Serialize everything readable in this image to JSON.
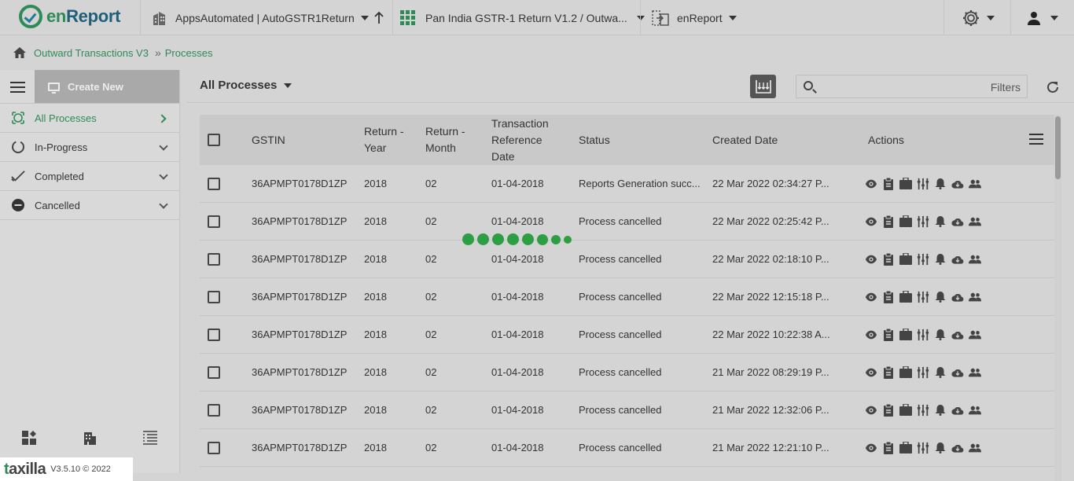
{
  "app": {
    "logo_text_en": "en",
    "logo_text_report": "Report",
    "brand_color": "#2e8b57"
  },
  "topbar": {
    "org": "AppsAutomated | AutoGSTR1Return",
    "workflow": "Pan India GSTR-1 Return V1.2 / Outwa...",
    "module": "enReport"
  },
  "breadcrumb": {
    "items": [
      "Outward Transactions V3",
      "Processes"
    ],
    "separator": "»"
  },
  "sidebar": {
    "create_label": "Create New",
    "items": [
      {
        "label": "All Processes",
        "icon": "all-processes-icon"
      },
      {
        "label": "In-Progress",
        "icon": "progress-icon"
      },
      {
        "label": "Completed",
        "icon": "check-icon"
      },
      {
        "label": "Cancelled",
        "icon": "minus-circle-icon"
      }
    ]
  },
  "main": {
    "title": "All Processes",
    "search_placeholder": "",
    "filters_label": "Filters"
  },
  "table": {
    "headers": {
      "gstin": "GSTIN",
      "year": "Return - Year",
      "month": "Return - Month",
      "trd_line1": "Transaction",
      "trd_line2": "Reference",
      "trd_line3": "Date",
      "status": "Status",
      "created": "Created Date",
      "actions": "Actions"
    },
    "rows": [
      {
        "gstin": "36APMPT0178D1ZP",
        "year": "2018",
        "month": "02",
        "trd": "01-04-2018",
        "status": "Reports Generation succ...",
        "created": "22 Mar 2022 02:34:27 P..."
      },
      {
        "gstin": "36APMPT0178D1ZP",
        "year": "2018",
        "month": "02",
        "trd": "01-04-2018",
        "status": "Process cancelled",
        "created": "22 Mar 2022 02:25:42 P..."
      },
      {
        "gstin": "36APMPT0178D1ZP",
        "year": "2018",
        "month": "02",
        "trd": "01-04-2018",
        "status": "Process cancelled",
        "created": "22 Mar 2022 02:18:10 P..."
      },
      {
        "gstin": "36APMPT0178D1ZP",
        "year": "2018",
        "month": "02",
        "trd": "01-04-2018",
        "status": "Process cancelled",
        "created": "22 Mar 2022 12:15:18 P..."
      },
      {
        "gstin": "36APMPT0178D1ZP",
        "year": "2018",
        "month": "02",
        "trd": "01-04-2018",
        "status": "Process cancelled",
        "created": "22 Mar 2022 10:22:38 A..."
      },
      {
        "gstin": "36APMPT0178D1ZP",
        "year": "2018",
        "month": "02",
        "trd": "01-04-2018",
        "status": "Process cancelled",
        "created": "21 Mar 2022 08:29:19 P..."
      },
      {
        "gstin": "36APMPT0178D1ZP",
        "year": "2018",
        "month": "02",
        "trd": "01-04-2018",
        "status": "Process cancelled",
        "created": "21 Mar 2022 12:32:06 P..."
      },
      {
        "gstin": "36APMPT0178D1ZP",
        "year": "2018",
        "month": "02",
        "trd": "01-04-2018",
        "status": "Process cancelled",
        "created": "21 Mar 2022 12:21:10 P..."
      }
    ],
    "action_icons": [
      "eye-icon",
      "clipboard-icon",
      "briefcase-icon",
      "columns-icon",
      "bell-icon",
      "cloud-download-icon",
      "users-icon"
    ]
  },
  "footer": {
    "brand_t": "t",
    "brand_rest": "axilla",
    "version": "V3.5.10 © 2022"
  }
}
